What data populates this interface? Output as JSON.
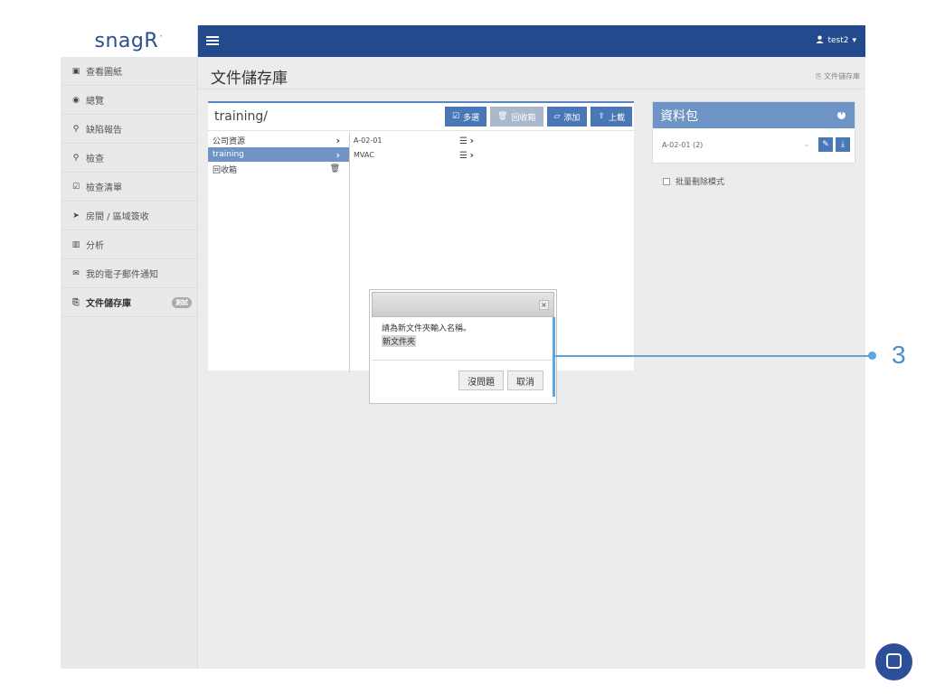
{
  "brand": {
    "logo_text": "snagR",
    "logo_mark": "·"
  },
  "topbar": {
    "user": "test2",
    "user_icon": "user-icon"
  },
  "sidebar": {
    "items": [
      {
        "label": "查看圖紙",
        "icon": "image-icon",
        "glyph": "▣"
      },
      {
        "label": "總覽",
        "icon": "dashboard-icon",
        "glyph": "◉"
      },
      {
        "label": "缺陷報告",
        "icon": "map-marker-icon",
        "glyph": "⚲"
      },
      {
        "label": "檢查",
        "icon": "search-icon",
        "glyph": "⚲"
      },
      {
        "label": "檢查清單",
        "icon": "checklist-icon",
        "glyph": "☑"
      },
      {
        "label": "房間 / 區域簽收",
        "icon": "arrow-icon",
        "glyph": "➤"
      },
      {
        "label": "分析",
        "icon": "chart-icon",
        "glyph": "▥"
      },
      {
        "label": "我的電子郵件通知",
        "icon": "mail-icon",
        "glyph": "✉"
      },
      {
        "label": "文件儲存庫",
        "icon": "storage-icon",
        "glyph": "⎘",
        "badge": "測試"
      }
    ]
  },
  "header": {
    "title": "文件儲存庫",
    "breadcrumb": "文件儲存庫"
  },
  "file_panel": {
    "path": "training/",
    "actions": {
      "multi_select": "多選",
      "recycle": "回收箱",
      "add": "添加",
      "upload": "上載"
    },
    "folders": [
      {
        "label": "公司資源",
        "marker": "›"
      },
      {
        "label": "training",
        "marker": "›"
      },
      {
        "label": "回收箱",
        "marker": "🗑"
      }
    ],
    "items": [
      {
        "label": "A-02-01"
      },
      {
        "label": "MVAC"
      }
    ]
  },
  "package_panel": {
    "title": "資料包",
    "selected": "A-02-01 (2)",
    "bulk_delete_label": "批量刪除模式"
  },
  "modal": {
    "message": "請為新文件夾輸入名稱。",
    "input_value": "新文件夾",
    "ok_label": "沒問題",
    "cancel_label": "取消"
  },
  "annotation": {
    "label": "3"
  }
}
